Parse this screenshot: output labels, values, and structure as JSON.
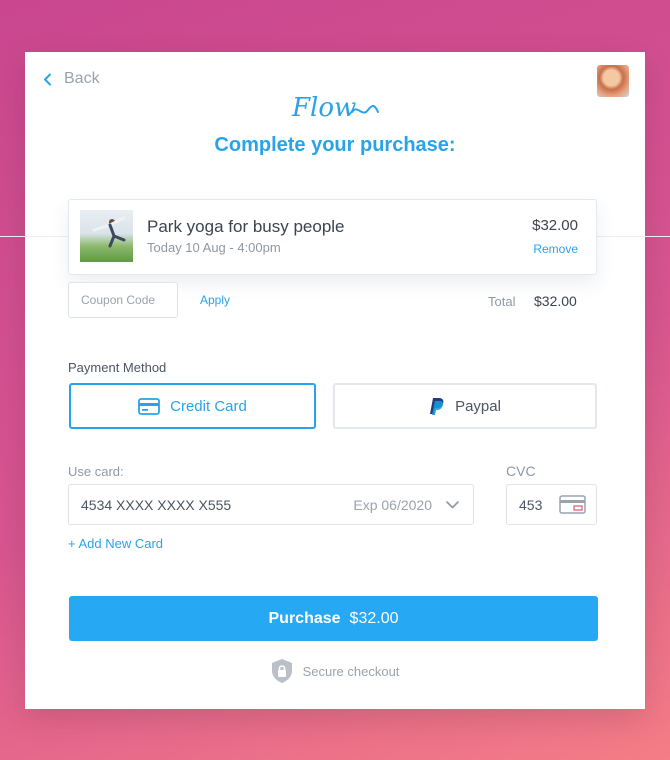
{
  "header": {
    "back_label": "Back",
    "logo_text": "Flow",
    "title": "Complete your purchase:"
  },
  "order_item": {
    "name": "Park yoga for busy people",
    "date": "Today 10 Aug - 4:00pm",
    "price": "$32.00",
    "remove_label": "Remove"
  },
  "coupon": {
    "placeholder": "Coupon Code",
    "apply_label": "Apply"
  },
  "total": {
    "label": "Total",
    "value": "$32.00"
  },
  "payment": {
    "label": "Payment Method",
    "methods": [
      {
        "label": "Credit Card",
        "icon": "credit-card-icon",
        "selected": true
      },
      {
        "label": "Paypal",
        "icon": "paypal-icon",
        "selected": false
      }
    ]
  },
  "card": {
    "use_card_label": "Use card:",
    "number": "4534 XXXX XXXX X555",
    "expiry": "Exp 06/2020",
    "cvc_label": "CVC",
    "cvc_value": "453",
    "add_new_label": "+ Add New Card"
  },
  "purchase": {
    "label": "Purchase",
    "amount": "$32.00"
  },
  "secure_label": "Secure checkout",
  "colors": {
    "accent": "#29a3e8",
    "button": "#26a8f2",
    "background_gradient": [
      "#c9478f",
      "#f47d86"
    ]
  }
}
